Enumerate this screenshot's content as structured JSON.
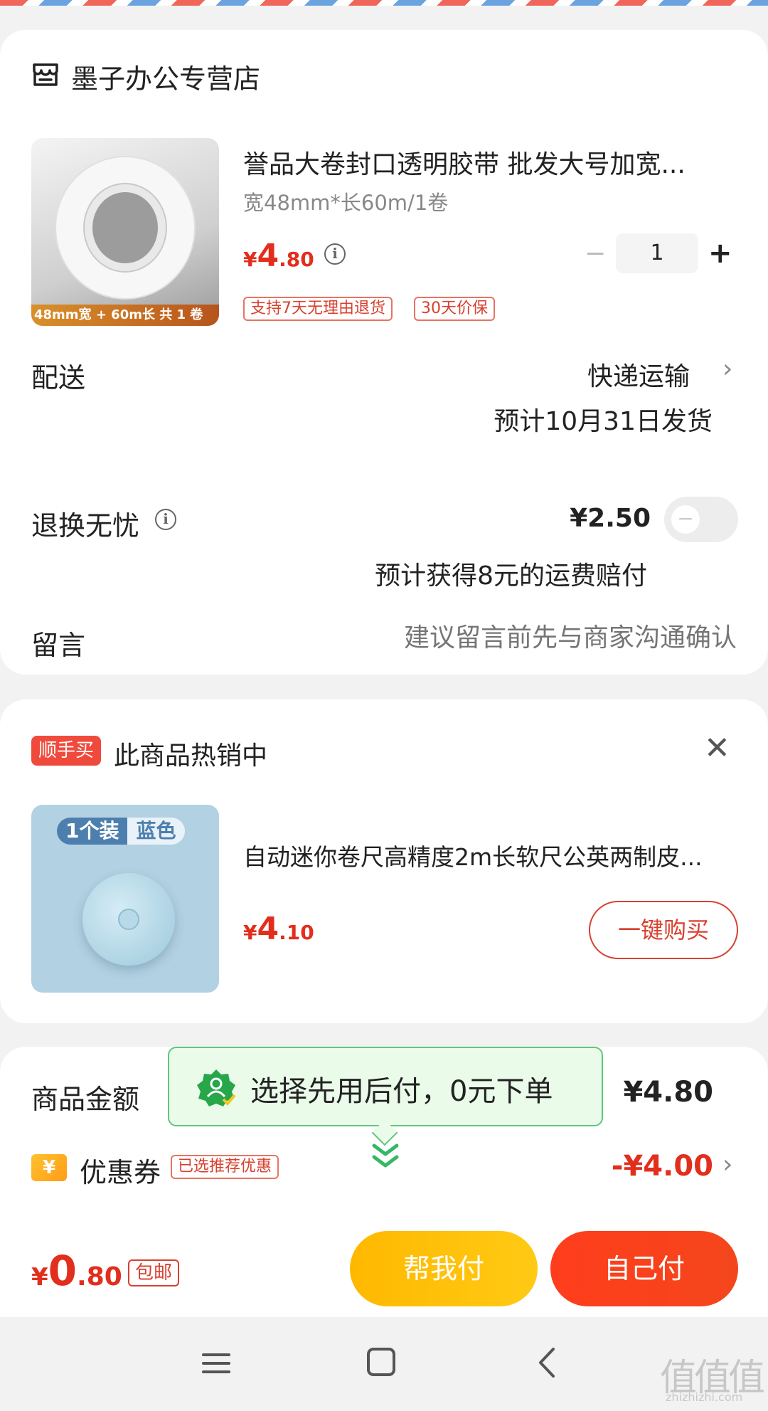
{
  "store": {
    "name": "墨子办公专营店",
    "icon": "store-icon"
  },
  "product": {
    "title": "誉品大卷封口透明胶带 批发大号加宽...",
    "spec": "宽48mm*长60m/1卷",
    "price": {
      "currency": "¥",
      "integer": "4",
      "decimal": ".80"
    },
    "quantity": "1",
    "minus_label": "−",
    "plus_label": "+",
    "image_band_text": "48mm宽 + 60m长 共 1 卷",
    "tags": [
      "支持7天无理由退货",
      "30天价保"
    ]
  },
  "delivery": {
    "label": "配送",
    "method": "快递运输",
    "chevron": "›",
    "ship_date": "预计10月31日发货"
  },
  "return_insurance": {
    "label": "退换无忧",
    "info_icon": "i",
    "price": "¥2.50",
    "toggle_knob": "−",
    "toggle_on": false,
    "compensation": "预计获得8元的运费赔付"
  },
  "message": {
    "label": "留言",
    "placeholder": "建议留言前先与商家沟通确认"
  },
  "upsell": {
    "badge": "顺手买",
    "title": "此商品热销中",
    "close_label": "✕",
    "item": {
      "tag_a": "1个装",
      "tag_b": "蓝色",
      "title": "自动迷你卷尺高精度2m长软尺公英两制皮...",
      "price": {
        "currency": "¥",
        "integer": "4",
        "decimal": ".10"
      },
      "buy_label": "一键购买"
    }
  },
  "summary": {
    "amount_label": "商品金额",
    "amount_value": "¥4.80",
    "coupon_icon_text": "¥",
    "coupon_label": "优惠券",
    "coupon_tag": "已选推荐优惠",
    "coupon_value": "-¥4.00",
    "coupon_chevron": "›"
  },
  "tooltip": {
    "text": "选择先用后付，0元下单"
  },
  "checkout": {
    "total": {
      "currency": "¥",
      "integer": "0",
      "decimal": ".80"
    },
    "free_shipping": "包邮",
    "help_pay": "帮我付",
    "self_pay": "自己付"
  },
  "watermark": {
    "main": "值值值",
    "sub": "zhizhizhi.com"
  },
  "colors": {
    "accent": "#e22e1d",
    "help_btn": "#ffbe0a",
    "self_btn": "#f4421c",
    "tooltip_bg": "#ebfbea"
  }
}
